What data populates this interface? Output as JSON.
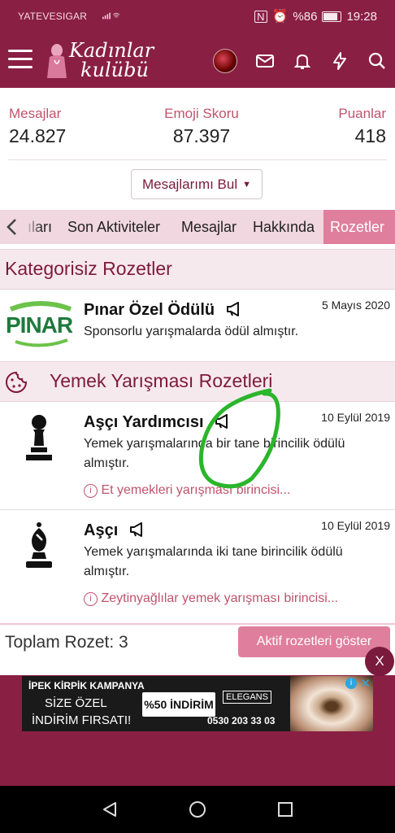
{
  "status": {
    "carrier": "YATEVESIGAR",
    "battery": "%86",
    "time": "19:28"
  },
  "header": {
    "logo_line1": "Kadınlar",
    "logo_line2": "kulübü"
  },
  "stats": {
    "messages_label": "Mesajlar",
    "messages_value": "24.827",
    "emoji_label": "Emoji Skoru",
    "emoji_value": "87.397",
    "points_label": "Puanlar",
    "points_value": "418"
  },
  "find_button": "Mesajlarımı Bul",
  "tabs": {
    "partial": "ıları",
    "items": [
      "Son Aktiviteler",
      "Mesajlar",
      "Hakkında"
    ],
    "active": "Rozetler"
  },
  "sections": [
    {
      "title": "Kategorisiz Rozetler",
      "badges": [
        {
          "logo_text": "PINAR",
          "title": "Pınar Özel Ödülü",
          "date": "5 Mayıs 2020",
          "desc": "Sponsorlu yarışmalarda ödül almıştır."
        }
      ]
    },
    {
      "title": "Yemek Yarışması Rozetleri",
      "badges": [
        {
          "title": "Aşçı Yardımcısı",
          "date": "10 Eylül 2019",
          "desc": "Yemek yarışmalarında bir tane birincilik ödülü almıştır.",
          "note": "Et yemekleri yarışması birincisi..."
        },
        {
          "title": "Aşçı",
          "date": "10 Eylül 2019",
          "desc": "Yemek yarışmalarında iki tane birincilik ödülü almıştır.",
          "note": "Zeytinyağlılar yemek yarışması birincisi..."
        }
      ]
    }
  ],
  "footer": {
    "total": "Toplam Rozet: 3",
    "active_button": "Aktif rozetleri göster",
    "close": "X"
  },
  "ad": {
    "line1": "İPEK KİRPİK KAMPANYA",
    "line2": "SİZE ÖZEL",
    "line3": "İNDİRİM FIRSATI!",
    "discount": "%50 İNDİRİM",
    "brand": "ELEGANS",
    "phone": "0530 203 33 03"
  },
  "colors": {
    "brand": "#8a1f44",
    "accent_pink": "#e07e9e",
    "title_text": "#7d1a3a",
    "annotation_circle": "#2bb52b"
  }
}
